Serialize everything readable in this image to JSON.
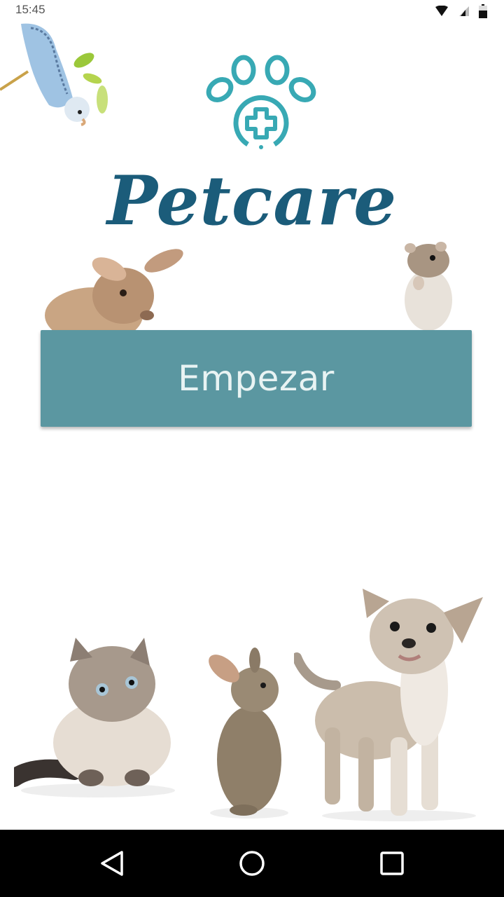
{
  "status_bar": {
    "time": "15:45",
    "icons": [
      "wifi-icon",
      "cell-signal-icon",
      "battery-icon"
    ]
  },
  "app": {
    "brand_name": "Petcare",
    "logo_icon": "paw-medical-cross-icon",
    "colors": {
      "brand": "#1b5c7a",
      "logo": "#38a9b4",
      "button": "#5b97a1",
      "button_text": "#e8f3f3"
    }
  },
  "actions": {
    "start_label": "Empezar"
  },
  "images": [
    "budgie",
    "rabbit",
    "hamster",
    "cat",
    "rabbit",
    "chihuahua-puppy"
  ],
  "nav_bar": {
    "buttons": [
      "back-icon",
      "home-icon",
      "recents-icon"
    ]
  }
}
